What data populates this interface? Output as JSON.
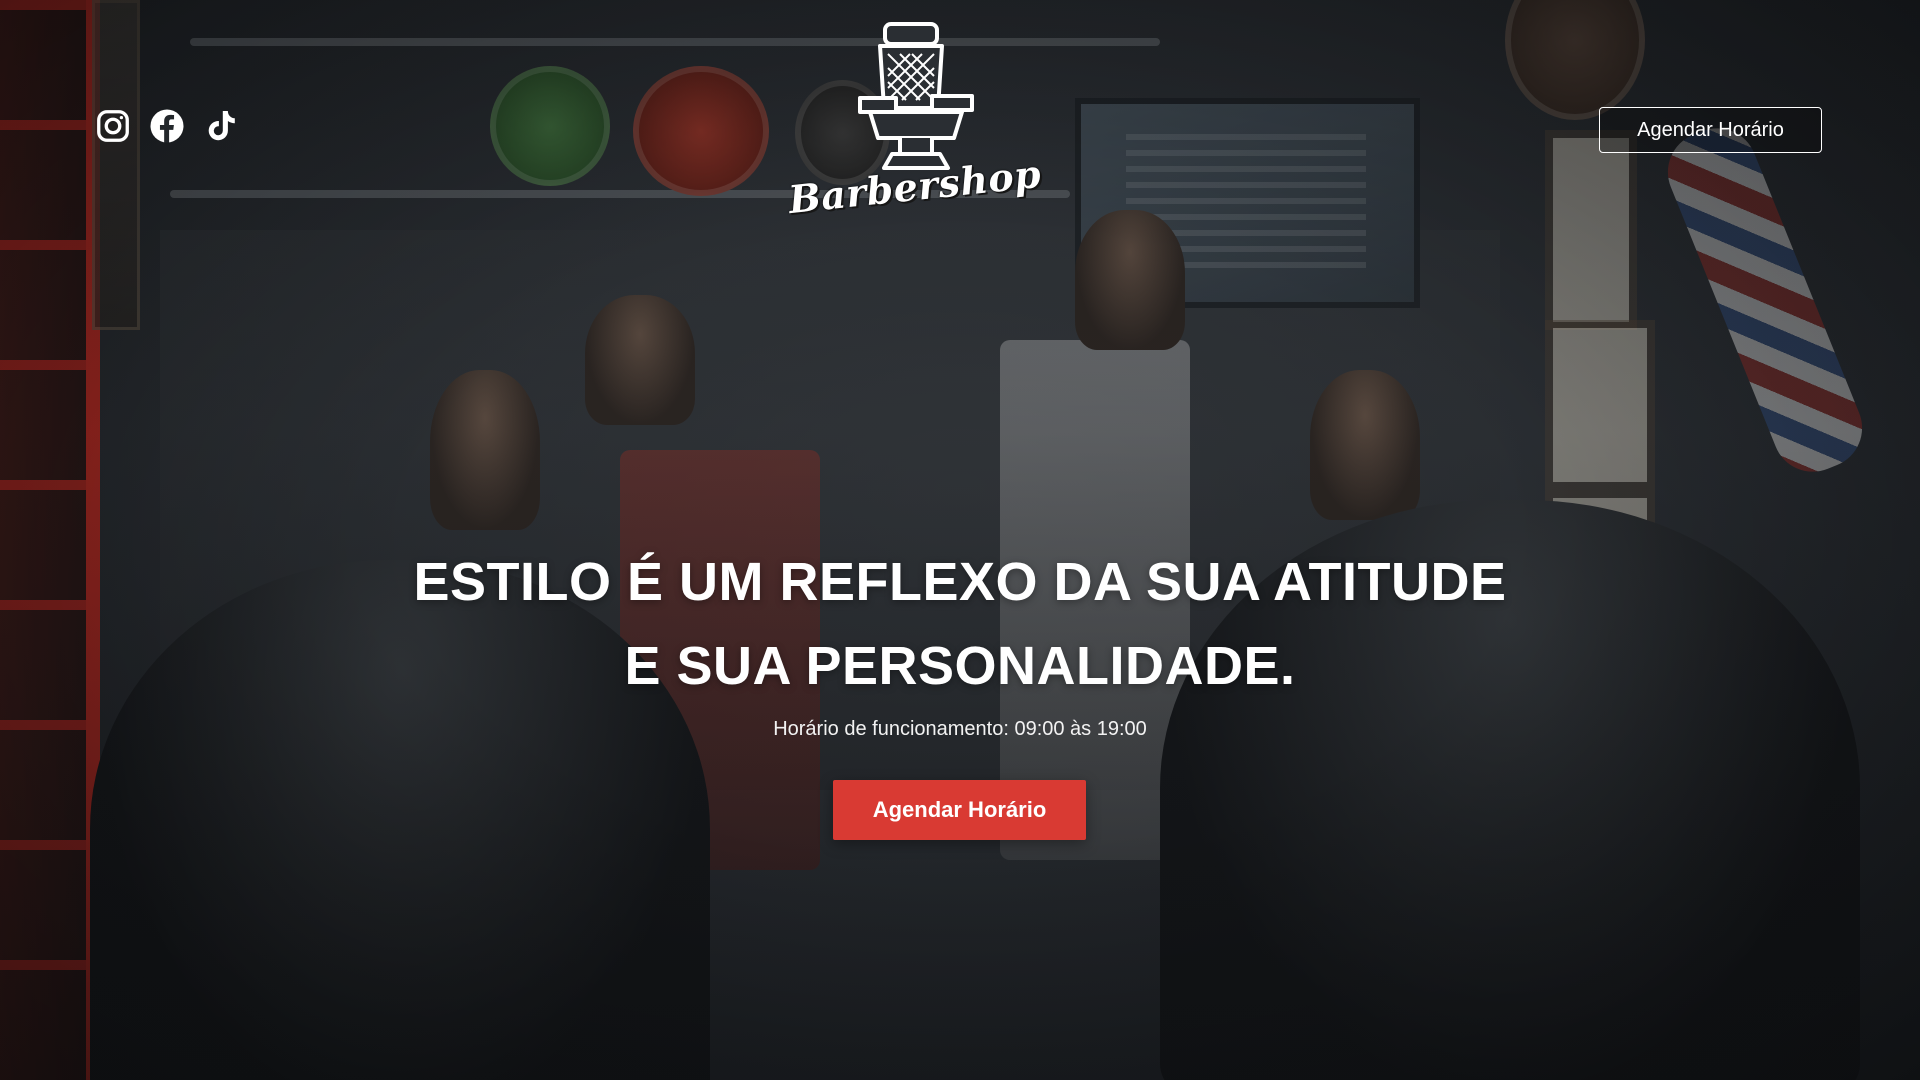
{
  "brand": {
    "logo_text": "Barbershop",
    "logo_icon": "barber-chair-icon"
  },
  "social": [
    {
      "name": "instagram",
      "icon": "instagram-icon"
    },
    {
      "name": "facebook",
      "icon": "facebook-icon"
    },
    {
      "name": "tiktok",
      "icon": "tiktok-icon"
    }
  ],
  "header": {
    "cta_label": "Agendar Horário"
  },
  "hero": {
    "headline_line1": "ESTILO É UM REFLEXO DA SUA ATITUDE",
    "headline_line2": "E SUA PERSONALIDADE.",
    "hours": "Horário de funcionamento: 09:00 às 19:00",
    "cta_label": "Agendar Horário"
  },
  "colors": {
    "accent": "#d93a33",
    "text": "#ffffff",
    "overlay": "#23272b"
  }
}
